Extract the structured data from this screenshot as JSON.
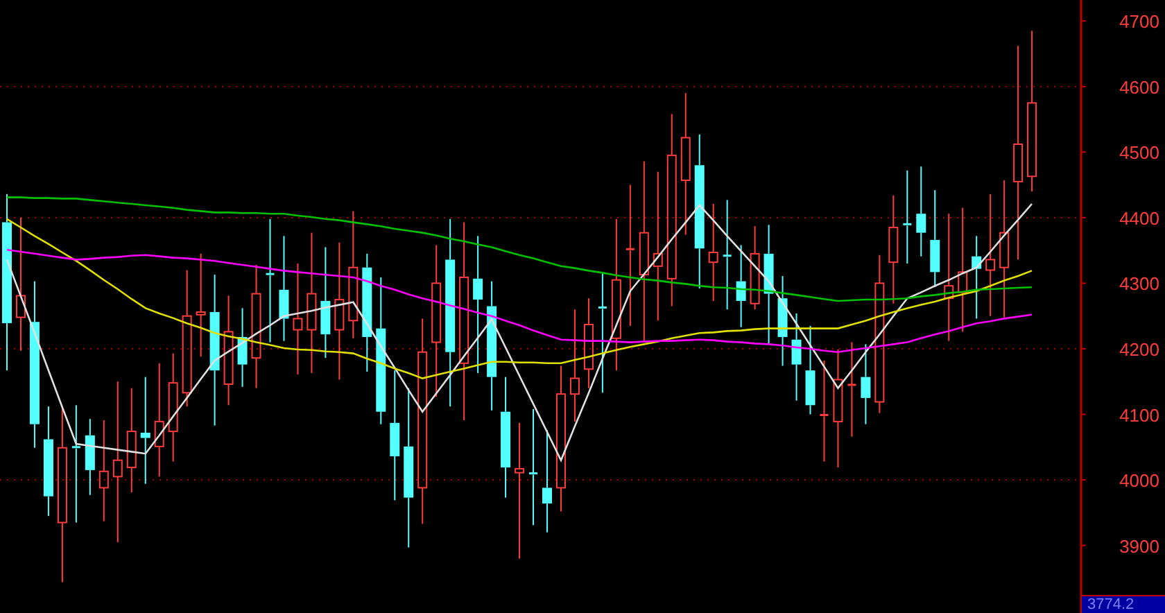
{
  "chart": {
    "chart_data": {
      "type": "candlestick",
      "ylim": [
        3797,
        4732
      ],
      "grid": true,
      "yticks": [
        {
          "value": 3900,
          "label": "3900"
        },
        {
          "value": 4000,
          "label": "4000"
        },
        {
          "value": 4100,
          "label": "4100"
        },
        {
          "value": 4200,
          "label": "4200"
        },
        {
          "value": 4300,
          "label": "4300"
        },
        {
          "value": 4400,
          "label": "4400"
        },
        {
          "value": 4500,
          "label": "4500"
        },
        {
          "value": 4600,
          "label": "4600"
        },
        {
          "value": 4700,
          "label": "4700"
        }
      ],
      "categories": [
        null,
        null,
        null,
        null,
        null,
        null,
        null,
        null,
        null,
        null,
        null,
        null,
        null,
        null,
        null,
        null,
        null,
        null,
        null,
        null,
        null,
        null,
        null,
        null,
        null,
        null,
        null,
        null,
        null,
        null,
        null,
        null,
        null,
        null,
        null,
        null,
        null,
        null,
        null,
        null,
        null,
        null,
        null,
        null,
        null,
        null,
        null,
        null,
        null,
        null,
        null,
        null,
        null,
        null,
        null,
        null,
        null,
        null,
        null,
        null,
        null,
        null,
        null,
        null,
        null,
        null,
        null,
        null,
        null,
        null,
        null,
        null,
        null,
        null,
        null,
        null,
        null,
        null
      ],
      "ohlc": [
        [
          4393,
          4436,
          4167,
          4239
        ],
        [
          4248,
          4400,
          4197,
          4281
        ],
        [
          4241,
          4303,
          4049,
          4085
        ],
        [
          4062,
          4112,
          3945,
          3975
        ],
        [
          3935,
          4112,
          3844,
          4049
        ],
        [
          4050,
          4114,
          3935,
          4048
        ],
        [
          4068,
          4093,
          3977,
          4015
        ],
        [
          3988,
          4091,
          3937,
          4013
        ],
        [
          4005,
          4150,
          3905,
          4030
        ],
        [
          4019,
          4140,
          3981,
          4074
        ],
        [
          4072,
          4157,
          3994,
          4064
        ],
        [
          4051,
          4178,
          4005,
          4089
        ],
        [
          4074,
          4193,
          4028,
          4148
        ],
        [
          4133,
          4320,
          4112,
          4250
        ],
        [
          4252,
          4345,
          4188,
          4256
        ],
        [
          4256,
          4313,
          4083,
          4167
        ],
        [
          4146,
          4281,
          4114,
          4226
        ],
        [
          4218,
          4262,
          4142,
          4176
        ],
        [
          4186,
          4328,
          4140,
          4284
        ],
        [
          4314,
          4398,
          4210,
          4312
        ],
        [
          4290,
          4372,
          4212,
          4246
        ],
        [
          4229,
          4330,
          4161,
          4246
        ],
        [
          4229,
          4377,
          4163,
          4284
        ],
        [
          4273,
          4355,
          4186,
          4222
        ],
        [
          4229,
          4362,
          4153,
          4275
        ],
        [
          4243,
          4410,
          4216,
          4324
        ],
        [
          4324,
          4345,
          4165,
          4218
        ],
        [
          4231,
          4309,
          4085,
          4104
        ],
        [
          4087,
          4167,
          3969,
          4036
        ],
        [
          4051,
          4140,
          3897,
          3973
        ],
        [
          3988,
          4246,
          3933,
          4195
        ],
        [
          4210,
          4358,
          4127,
          4300
        ],
        [
          4336,
          4398,
          4112,
          4195
        ],
        [
          4178,
          4393,
          4091,
          4309
        ],
        [
          4307,
          4372,
          4163,
          4275
        ],
        [
          4265,
          4303,
          4106,
          4157
        ],
        [
          4104,
          4157,
          3973,
          4019
        ],
        [
          4011,
          4087,
          3880,
          4017
        ],
        [
          4010,
          4108,
          3931,
          4008
        ],
        [
          3988,
          4076,
          3920,
          3964
        ],
        [
          3988,
          4174,
          3952,
          4131
        ],
        [
          4131,
          4260,
          4089,
          4155
        ],
        [
          4169,
          4277,
          4140,
          4237
        ],
        [
          4263,
          4315,
          4133,
          4261
        ],
        [
          4216,
          4398,
          4167,
          4305
        ],
        [
          4350,
          4450,
          4235,
          4352
        ],
        [
          4313,
          4486,
          4212,
          4377
        ],
        [
          4326,
          4470,
          4243,
          4345
        ],
        [
          4307,
          4558,
          4265,
          4495
        ],
        [
          4457,
          4590,
          4374,
          4522
        ],
        [
          4480,
          4527,
          4292,
          4353
        ],
        [
          4332,
          4421,
          4273,
          4347
        ],
        [
          4342,
          4427,
          4260,
          4340
        ],
        [
          4303,
          4358,
          4233,
          4273
        ],
        [
          4269,
          4387,
          4260,
          4345
        ],
        [
          4345,
          4389,
          4207,
          4284
        ],
        [
          4277,
          4311,
          4174,
          4218
        ],
        [
          4214,
          4254,
          4121,
          4176
        ],
        [
          4167,
          4235,
          4100,
          4114
        ],
        [
          4097,
          4182,
          4028,
          4099
        ],
        [
          4089,
          4199,
          4019,
          4153
        ],
        [
          4143,
          4210,
          4066,
          4145
        ],
        [
          4157,
          4207,
          4085,
          4125
        ],
        [
          4119,
          4343,
          4102,
          4300
        ],
        [
          4332,
          4434,
          4269,
          4385
        ],
        [
          4390,
          4472,
          4330,
          4388
        ],
        [
          4406,
          4478,
          4341,
          4377
        ],
        [
          4366,
          4442,
          4294,
          4317
        ],
        [
          4277,
          4406,
          4212,
          4296
        ],
        [
          4286,
          4415,
          4226,
          4317
        ],
        [
          4341,
          4372,
          4246,
          4322
        ],
        [
          4320,
          4436,
          4250,
          4336
        ],
        [
          4324,
          4457,
          4248,
          4377
        ],
        [
          4455,
          4662,
          4336,
          4512
        ],
        [
          4463,
          4685,
          4440,
          4575
        ],
        null,
        null,
        null
      ],
      "series": [
        {
          "type": "line",
          "color": "#e0e0e0",
          "values": [
            4336,
            4280,
            4224,
            4167,
            4111,
            4055,
            4052,
            4049,
            4046,
            4043,
            4040,
            4068,
            4097,
            4125,
            4154,
            4182,
            4196,
            4209,
            4223,
            4236,
            4250,
            4254,
            4258,
            4263,
            4267,
            4271,
            4238,
            4204,
            4171,
            4137,
            4104,
            4132,
            4160,
            4189,
            4217,
            4245,
            4202,
            4159,
            4116,
            4073,
            4030,
            4082,
            4133,
            4185,
            4236,
            4288,
            4314,
            4340,
            4367,
            4393,
            4419,
            4396,
            4372,
            4349,
            4326,
            4303,
            4270,
            4238,
            4205,
            4173,
            4140,
            4167,
            4195,
            4222,
            4250,
            4277,
            4286,
            4296,
            4305,
            4315,
            4324,
            4348,
            4373,
            4397,
            4421,
            null,
            null,
            null
          ]
        },
        {
          "type": "line",
          "color": "#e0e000",
          "values": [
            4398,
            4385,
            4372,
            4360,
            4347,
            4334,
            4320,
            4305,
            4291,
            4276,
            4262,
            4254,
            4247,
            4239,
            4232,
            4224,
            4219,
            4215,
            4210,
            4206,
            4201,
            4199,
            4198,
            4196,
            4195,
            4193,
            4185,
            4178,
            4170,
            4163,
            4155,
            4160,
            4165,
            4170,
            4175,
            4180,
            4180,
            4179,
            4179,
            4178,
            4178,
            4183,
            4188,
            4193,
            4198,
            4203,
            4207,
            4211,
            4216,
            4220,
            4224,
            4225,
            4227,
            4228,
            4230,
            4231,
            4231,
            4231,
            4231,
            4231,
            4231,
            4237,
            4243,
            4250,
            4256,
            4262,
            4267,
            4272,
            4278,
            4283,
            4288,
            4296,
            4304,
            4311,
            4319,
            null,
            null,
            null
          ]
        },
        {
          "type": "line",
          "color": "#ff00ff",
          "values": [
            4351,
            4348,
            4345,
            4342,
            4339,
            4336,
            4337,
            4339,
            4340,
            4342,
            4343,
            4341,
            4339,
            4338,
            4336,
            4334,
            4331,
            4328,
            4325,
            4322,
            4319,
            4317,
            4315,
            4313,
            4311,
            4309,
            4303,
            4296,
            4290,
            4283,
            4277,
            4272,
            4266,
            4261,
            4255,
            4250,
            4243,
            4236,
            4228,
            4221,
            4214,
            4213,
            4212,
            4212,
            4211,
            4210,
            4211,
            4212,
            4212,
            4213,
            4214,
            4213,
            4211,
            4210,
            4208,
            4207,
            4205,
            4202,
            4200,
            4197,
            4195,
            4198,
            4201,
            4204,
            4207,
            4210,
            4216,
            4222,
            4227,
            4233,
            4239,
            4242,
            4246,
            4249,
            4252,
            null,
            null,
            null
          ]
        },
        {
          "type": "line",
          "color": "#00c000",
          "values": [
            4431,
            4431,
            4430,
            4430,
            4429,
            4429,
            4427,
            4425,
            4423,
            4421,
            4419,
            4417,
            4415,
            4412,
            4410,
            4408,
            4408,
            4407,
            4407,
            4406,
            4406,
            4403,
            4401,
            4398,
            4396,
            4393,
            4390,
            4387,
            4383,
            4380,
            4377,
            4373,
            4368,
            4364,
            4359,
            4355,
            4349,
            4343,
            4338,
            4332,
            4326,
            4323,
            4319,
            4316,
            4312,
            4309,
            4306,
            4304,
            4301,
            4299,
            4296,
            4294,
            4293,
            4291,
            4290,
            4288,
            4285,
            4282,
            4279,
            4276,
            4273,
            4274,
            4275,
            4275,
            4276,
            4277,
            4280,
            4282,
            4285,
            4287,
            4290,
            4291,
            4292,
            4293,
            4294,
            null,
            null,
            null
          ]
        }
      ]
    },
    "last_price": "3774.2"
  }
}
